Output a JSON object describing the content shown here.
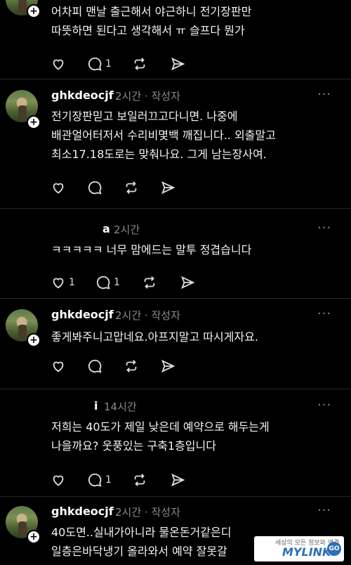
{
  "posts": [
    {
      "lines": [
        "어차피 맨날 출근해서 야근하니 전기장판만",
        "따뜻하면 된다고 생각해서 ㅠ 슬프다 뭔가"
      ],
      "reply_count": "1"
    },
    {
      "username": "ghkdeocjf",
      "time": "2시간",
      "author_tag": "· 작성자",
      "lines": [
        "전기장판믿고 보일러끄고다니면. 나중에",
        "배관얼어터저서 수리비몇백 깨집니다.. 외출말고",
        "최소17.18도로는 맞춰나요. 그게 남는장사여."
      ]
    },
    {
      "username_partial": "a",
      "time": "2시간",
      "lines": [
        "ㅋㅋㅋㅋㅋ 너무 맘에드는 말투 정겹습니다"
      ],
      "like_count": "1",
      "reply_count": "1"
    },
    {
      "username": "ghkdeocjf",
      "time": "2시간",
      "author_tag": "· 작성자",
      "lines": [
        "좋게봐주니고맙네요.아프지말고 따시게자요."
      ]
    },
    {
      "username_partial": "i",
      "time": "14시간",
      "lines": [
        "저희는 40도가 제일 낮은데 예약으로 해두는게",
        "나을까요? 웃풍있는 구축1층입니다"
      ],
      "reply_count": "1"
    },
    {
      "username": "ghkdeocjf",
      "time": "2시간",
      "author_tag": "· 작성자",
      "lines": [
        "40도면..실내가아니라 물온돈거같은디",
        "일층은바닥냉기 올라와서 예약 잘못갈"
      ]
    }
  ],
  "more_label": "···",
  "watermark": {
    "tagline": "세상의 모든 정보와 연결",
    "logo": "MYLINK",
    "go": "GO"
  },
  "icons": {
    "like": "heart-icon",
    "reply": "comment-icon",
    "repost": "repost-icon",
    "share": "send-icon"
  }
}
